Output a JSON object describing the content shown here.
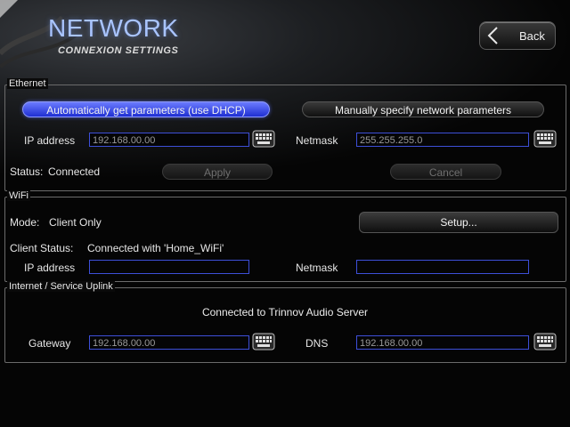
{
  "header": {
    "title": "NETWORK",
    "subtitle": "CONNEXION SETTINGS",
    "back_label": "Back"
  },
  "ethernet": {
    "section_title": "Ethernet",
    "dhcp_button": "Automatically get parameters (use DHCP)",
    "manual_button": "Manually specify network parameters",
    "ip_label": "IP address",
    "ip_value": "192.168.00.00",
    "netmask_label": "Netmask",
    "netmask_value": "255.255.255.0",
    "status_label": "Status:",
    "status_value": "Connected",
    "apply_button": "Apply",
    "cancel_button": "Cancel"
  },
  "wifi": {
    "section_title": "WiFi",
    "mode_label": "Mode:",
    "mode_value": "Client Only",
    "setup_button": "Setup...",
    "client_status_label": "Client Status:",
    "client_status_value": "Connected with 'Home_WiFi'",
    "ip_label": "IP address",
    "ip_value": "",
    "netmask_label": "Netmask",
    "netmask_value": ""
  },
  "uplink": {
    "section_title": "Internet / Service Uplink",
    "status_text": "Connected to Trinnov Audio Server",
    "gateway_label": "Gateway",
    "gateway_value": "192.168.00.00",
    "dns_label": "DNS",
    "dns_value": "192.168.00.00"
  },
  "colors": {
    "accent_blue": "#1f2fd2",
    "field_border": "#3d4fd8",
    "title_blue": "#a9c4ff"
  },
  "icons": {
    "keyboard": "keyboard-icon",
    "back": "chevron-left-icon"
  }
}
